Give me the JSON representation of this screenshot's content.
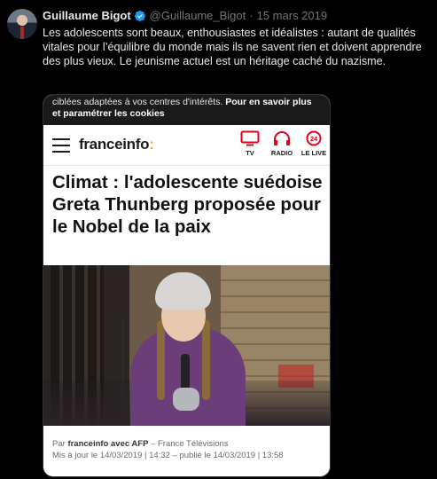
{
  "tweet": {
    "author_name": "Guillaume Bigot",
    "handle": "@Guillaume_Bigot",
    "date": "15 mars 2019",
    "text": "Les adolescents sont beaux, enthousiastes et idéalistes : autant de qualités vitales pour l’équilibre du monde mais ils ne savent rien et doivent apprendre des plus vieux. Le jeunisme actuel est un héritage caché du nazisme."
  },
  "card": {
    "cookie_text": "ciblées adaptées à vos centres d'intérêts.",
    "cookie_link": "Pour en savoir plus et paramétrer les cookies",
    "site_logo": "franceinfo",
    "site_logo_colon": ":",
    "nav": [
      {
        "label": "TV",
        "icon": "tv-icon"
      },
      {
        "label": "RADIO",
        "icon": "headphones-icon"
      },
      {
        "label": "LE LIVE",
        "icon": "live-24-icon"
      }
    ],
    "live_badge": "24",
    "headline": "Climat : l'adolescente suédoise Greta Thunberg proposée pour le Nobel de la paix",
    "byline_prefix": "Par",
    "byline_source": "franceinfo avec AFP",
    "byline_suffix": "– France Télévisions",
    "updated": "Mis à jour le 14/03/2019 | 14:32 – publié le 14/03/2019 | 13:58"
  },
  "colors": {
    "background": "#000000",
    "text_primary": "#e7e9ea",
    "text_secondary": "#71767b",
    "verified_blue": "#1d9bf0",
    "franceinfo_red": "#e2001a",
    "franceinfo_yellow": "#f5a623"
  }
}
